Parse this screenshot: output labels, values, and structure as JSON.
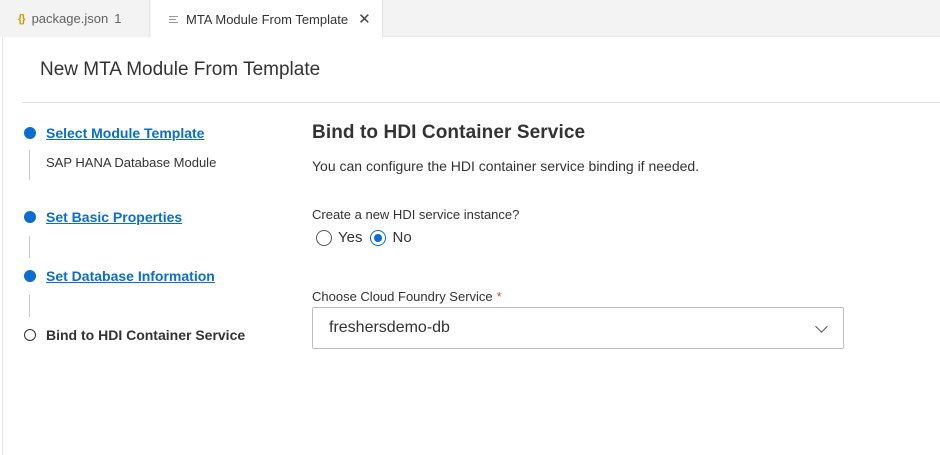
{
  "tabs": [
    {
      "icon": "json-braces-icon",
      "glyph": "{}",
      "label": "package.json",
      "badge": "1",
      "active": false
    },
    {
      "icon": "lines-file-icon",
      "label": "MTA Module From Template",
      "active": true
    }
  ],
  "close_glyph": "✕",
  "page_title": "New MTA Module From Template",
  "steps": [
    {
      "label": "Select Module Template",
      "sub": "SAP HANA Database Module",
      "state": "completed"
    },
    {
      "label": "Set Basic Properties",
      "state": "completed"
    },
    {
      "label": "Set Database Information",
      "state": "completed"
    },
    {
      "label": "Bind to HDI Container Service",
      "state": "current"
    }
  ],
  "form": {
    "title": "Bind to HDI Container Service",
    "description": "You can configure the HDI container service binding if needed.",
    "question": "Create a new HDI service instance?",
    "options": [
      {
        "label": "Yes",
        "checked": false
      },
      {
        "label": "No",
        "checked": true
      }
    ],
    "service_label": "Choose Cloud Foundry Service",
    "required_mark": "*",
    "service_value": "freshersdemo-db"
  },
  "colors": {
    "accent": "#0a6ed1",
    "required": "#d04343",
    "text": "#333333"
  }
}
